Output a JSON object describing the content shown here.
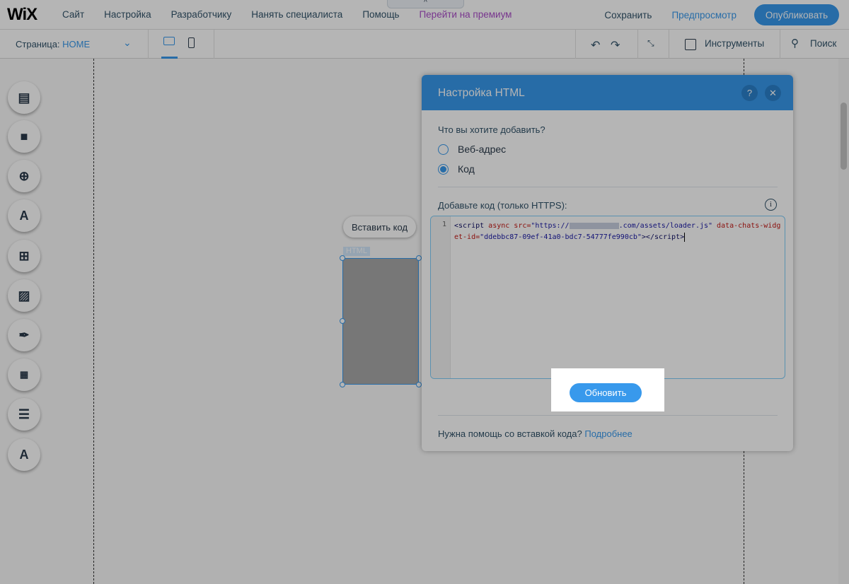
{
  "topbar": {
    "logo": "WiX",
    "menu": [
      "Сайт",
      "Настройка",
      "Разработчику",
      "Нанять специалиста",
      "Помощь",
      "Перейти на премиум"
    ],
    "save": "Сохранить",
    "preview": "Предпросмотр",
    "publish": "Опубликовать",
    "collapse_icon": "^"
  },
  "subbar": {
    "page_label": "Страница:",
    "page_value": "HOME",
    "tools": "Инструменты",
    "search": "Поиск"
  },
  "canvas": {
    "paste_code": "Вставить код",
    "html_tag": "HTML"
  },
  "dialog": {
    "title": "Настройка HTML",
    "help": "?",
    "close": "✕",
    "question": "Что вы хотите добавить?",
    "option_web": "Веб-адрес",
    "option_code": "Код",
    "selected": "Код",
    "code_label": "Добавьте код (только HTTPS):",
    "line_no": "1",
    "code": {
      "open": "<script ",
      "async": "async ",
      "src_attr": "src=",
      "src_start": "\"https://",
      "src_end": ".com/assets/loader.js\"",
      "data_attr": " data-chats-widget-id=",
      "data_val": "\"ddebbc87-09ef-41a0-bdc7-54777fe990cb\"",
      "close": "></script>"
    },
    "update": "Обновить",
    "help_text": "Нужна помощь со вставкой кода?",
    "help_link": "Подробнее"
  },
  "colors": {
    "accent": "#3899ec",
    "premium": "#aa4dc8"
  }
}
